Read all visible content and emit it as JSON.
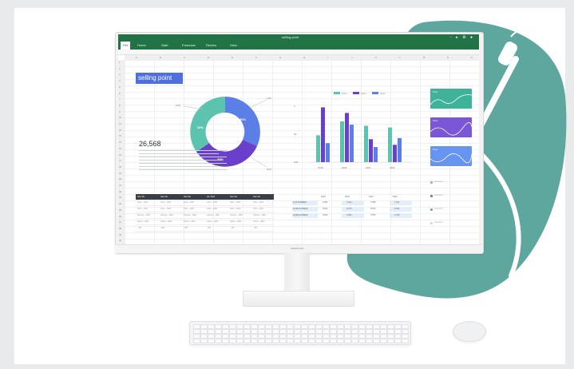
{
  "window": {
    "title": "selling point"
  },
  "ribbon": {
    "tabs": [
      {
        "label": "File"
      },
      {
        "label": "Home"
      },
      {
        "label": "Start"
      },
      {
        "label": "Formulas"
      },
      {
        "label": "Review"
      },
      {
        "label": "View"
      }
    ]
  },
  "columns": [
    "A",
    "B",
    "C",
    "D",
    "E",
    "F",
    "G",
    "H",
    "I",
    "J",
    "K",
    "L",
    "M",
    "N",
    "O"
  ],
  "rows": [
    "1",
    "2",
    "3",
    "4",
    "5",
    "6",
    "7",
    "8",
    "9",
    "10",
    "11",
    "12",
    "13",
    "14",
    "15",
    "16",
    "17",
    "18",
    "19",
    "20",
    "21",
    "22",
    "23",
    "24",
    "25",
    "26",
    "27",
    "28",
    "29",
    "30"
  ],
  "sheet": {
    "heading": "selling point",
    "big_number": "26,568"
  },
  "left_table": {
    "headers": [
      "Item list",
      "Item list",
      "Item list",
      "Ad. Sold",
      "Item list",
      "Item list"
    ],
    "rows": [
      [
        "Xxxx - 10%",
        "Xxxx - 10%",
        "Xxxx - 10%",
        "Xxxx - 10%",
        "Xxxx - 10%",
        "Xxxx - 10%"
      ],
      [
        "Xxxx - 10%",
        "Xxxx - 10%",
        "Xxxx - 10%",
        "Xxxx - 10%",
        "Xxxx - 10%",
        "Xxxx - 10%"
      ],
      [
        "Xxxxxx - 10%",
        "Xxxxxx - 10%",
        "Xxxxxx - 10%",
        "Xxxxxx - 10%",
        "Xxxxxx - 10%",
        "Xxxxxx - 10%"
      ],
      [
        "Xxxxx - 10%",
        "Xxxxx - 10%",
        "Xxxxx - 10%",
        "Xxxxx - 10%",
        "Xxxxx - 10%",
        "Xxxxx - 10%"
      ],
      [
        "- 5%",
        "- 8%",
        "- 5%",
        "- 5%",
        "- 7%",
        "- 3%"
      ]
    ]
  },
  "right_table": {
    "headers": [
      "2019",
      "2020",
      "2021",
      "2022"
    ],
    "rows": [
      {
        "label": "1Q3 NUMBER",
        "values": [
          "2,354",
          "7,542",
          "7,845",
          "7,511"
        ]
      },
      {
        "label": "2Q4B NUMBER",
        "values": [
          "5,544",
          "8,975",
          "8,574",
          "5,542"
        ]
      },
      {
        "label": "3Q4B NUMBER",
        "values": [
          "4,544",
          "2,553",
          "7,874",
          "4,745"
        ]
      }
    ]
  },
  "donut": {
    "labels": [
      "25%",
      "30%",
      "35%"
    ],
    "callouts": [
      "10%",
      "10%",
      "10%"
    ]
  },
  "bar_chart": {
    "legend": [
      "Xxxx",
      "Xxxx",
      "Xxxx"
    ],
    "y_ticks": [
      "100",
      "50",
      "0"
    ],
    "categories": [
      "2019",
      "2020",
      "2021",
      "2022"
    ]
  },
  "mini_cards": [
    {
      "title": "Xxxx",
      "color": "#3fb39a"
    },
    {
      "title": "Xxxx",
      "color": "#7b56d6"
    },
    {
      "title": "Xxxx",
      "color": "#6694f0"
    }
  ],
  "side_legend": [
    "Xxxxxxxx",
    "Xxxxxxxx",
    "Xxxxxxxx",
    "Xxxxxxxx"
  ],
  "monitor": {
    "brand": "SAMSUNG"
  },
  "chart_data": {
    "type": "bar",
    "categories": [
      "2019",
      "2020",
      "2021",
      "2022"
    ],
    "series": [
      {
        "name": "Xxxx",
        "values": [
          48,
          73,
          65,
          62
        ]
      },
      {
        "name": "Xxxx",
        "values": [
          98,
          88,
          41,
          31
        ]
      },
      {
        "name": "Xxxx",
        "values": [
          34,
          67,
          27,
          43
        ]
      }
    ],
    "ylim": [
      0,
      120
    ],
    "colors": [
      "#5cc4ae",
      "#6a3fcc",
      "#5b7fe6"
    ]
  },
  "colors": {
    "excel_green": "#217346",
    "teal_shape": "#5ea79e",
    "accent_blue": "#4f6fe0"
  }
}
